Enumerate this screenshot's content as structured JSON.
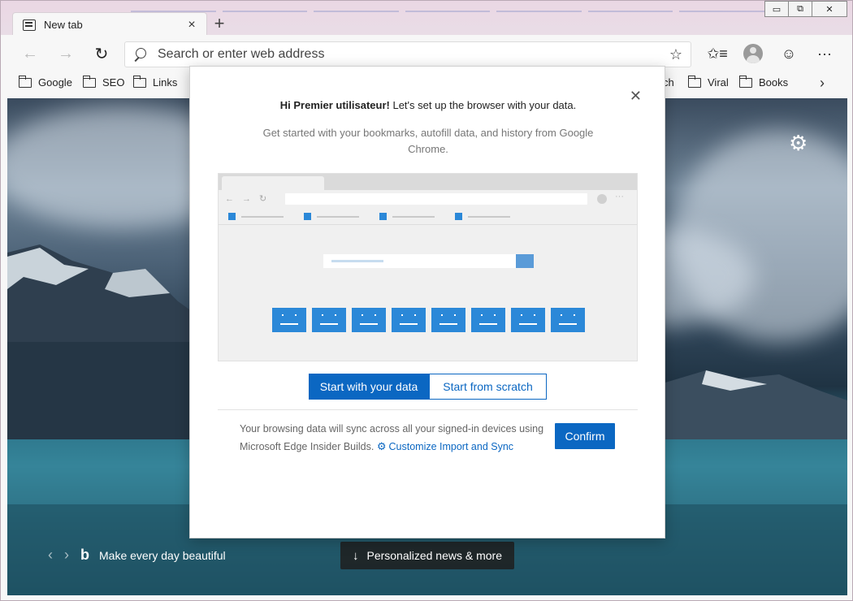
{
  "tab": {
    "title": "New tab"
  },
  "window_controls": {
    "minimize": "▭",
    "maximize": "⧉",
    "close": "✕"
  },
  "toolbar": {
    "back_icon": "arrow-left-icon",
    "forward_icon": "arrow-right-icon",
    "refresh_icon": "refresh-icon",
    "address_placeholder": "Search or enter web address"
  },
  "bookmarks": [
    {
      "label": "Google"
    },
    {
      "label": "SEO"
    },
    {
      "label": "Links"
    },
    {
      "label": "ch"
    },
    {
      "label": "Viral"
    },
    {
      "label": "Books"
    }
  ],
  "dialog": {
    "greeting_bold": "Hi Premier utilisateur!",
    "greeting_rest": " Let's set up the browser with your data.",
    "subtitle": "Get started with your bookmarks, autofill data, and history from Google Chrome.",
    "option_primary": "Start with your data",
    "option_secondary": "Start from scratch",
    "sync_text": "Your browsing data will sync across all your signed-in devices using Microsoft Edge Insider Builds.",
    "sync_link": "Customize Import and Sync",
    "confirm": "Confirm"
  },
  "newtab": {
    "tagline": "Make every day beautiful",
    "news_button": "Personalized news & more"
  }
}
